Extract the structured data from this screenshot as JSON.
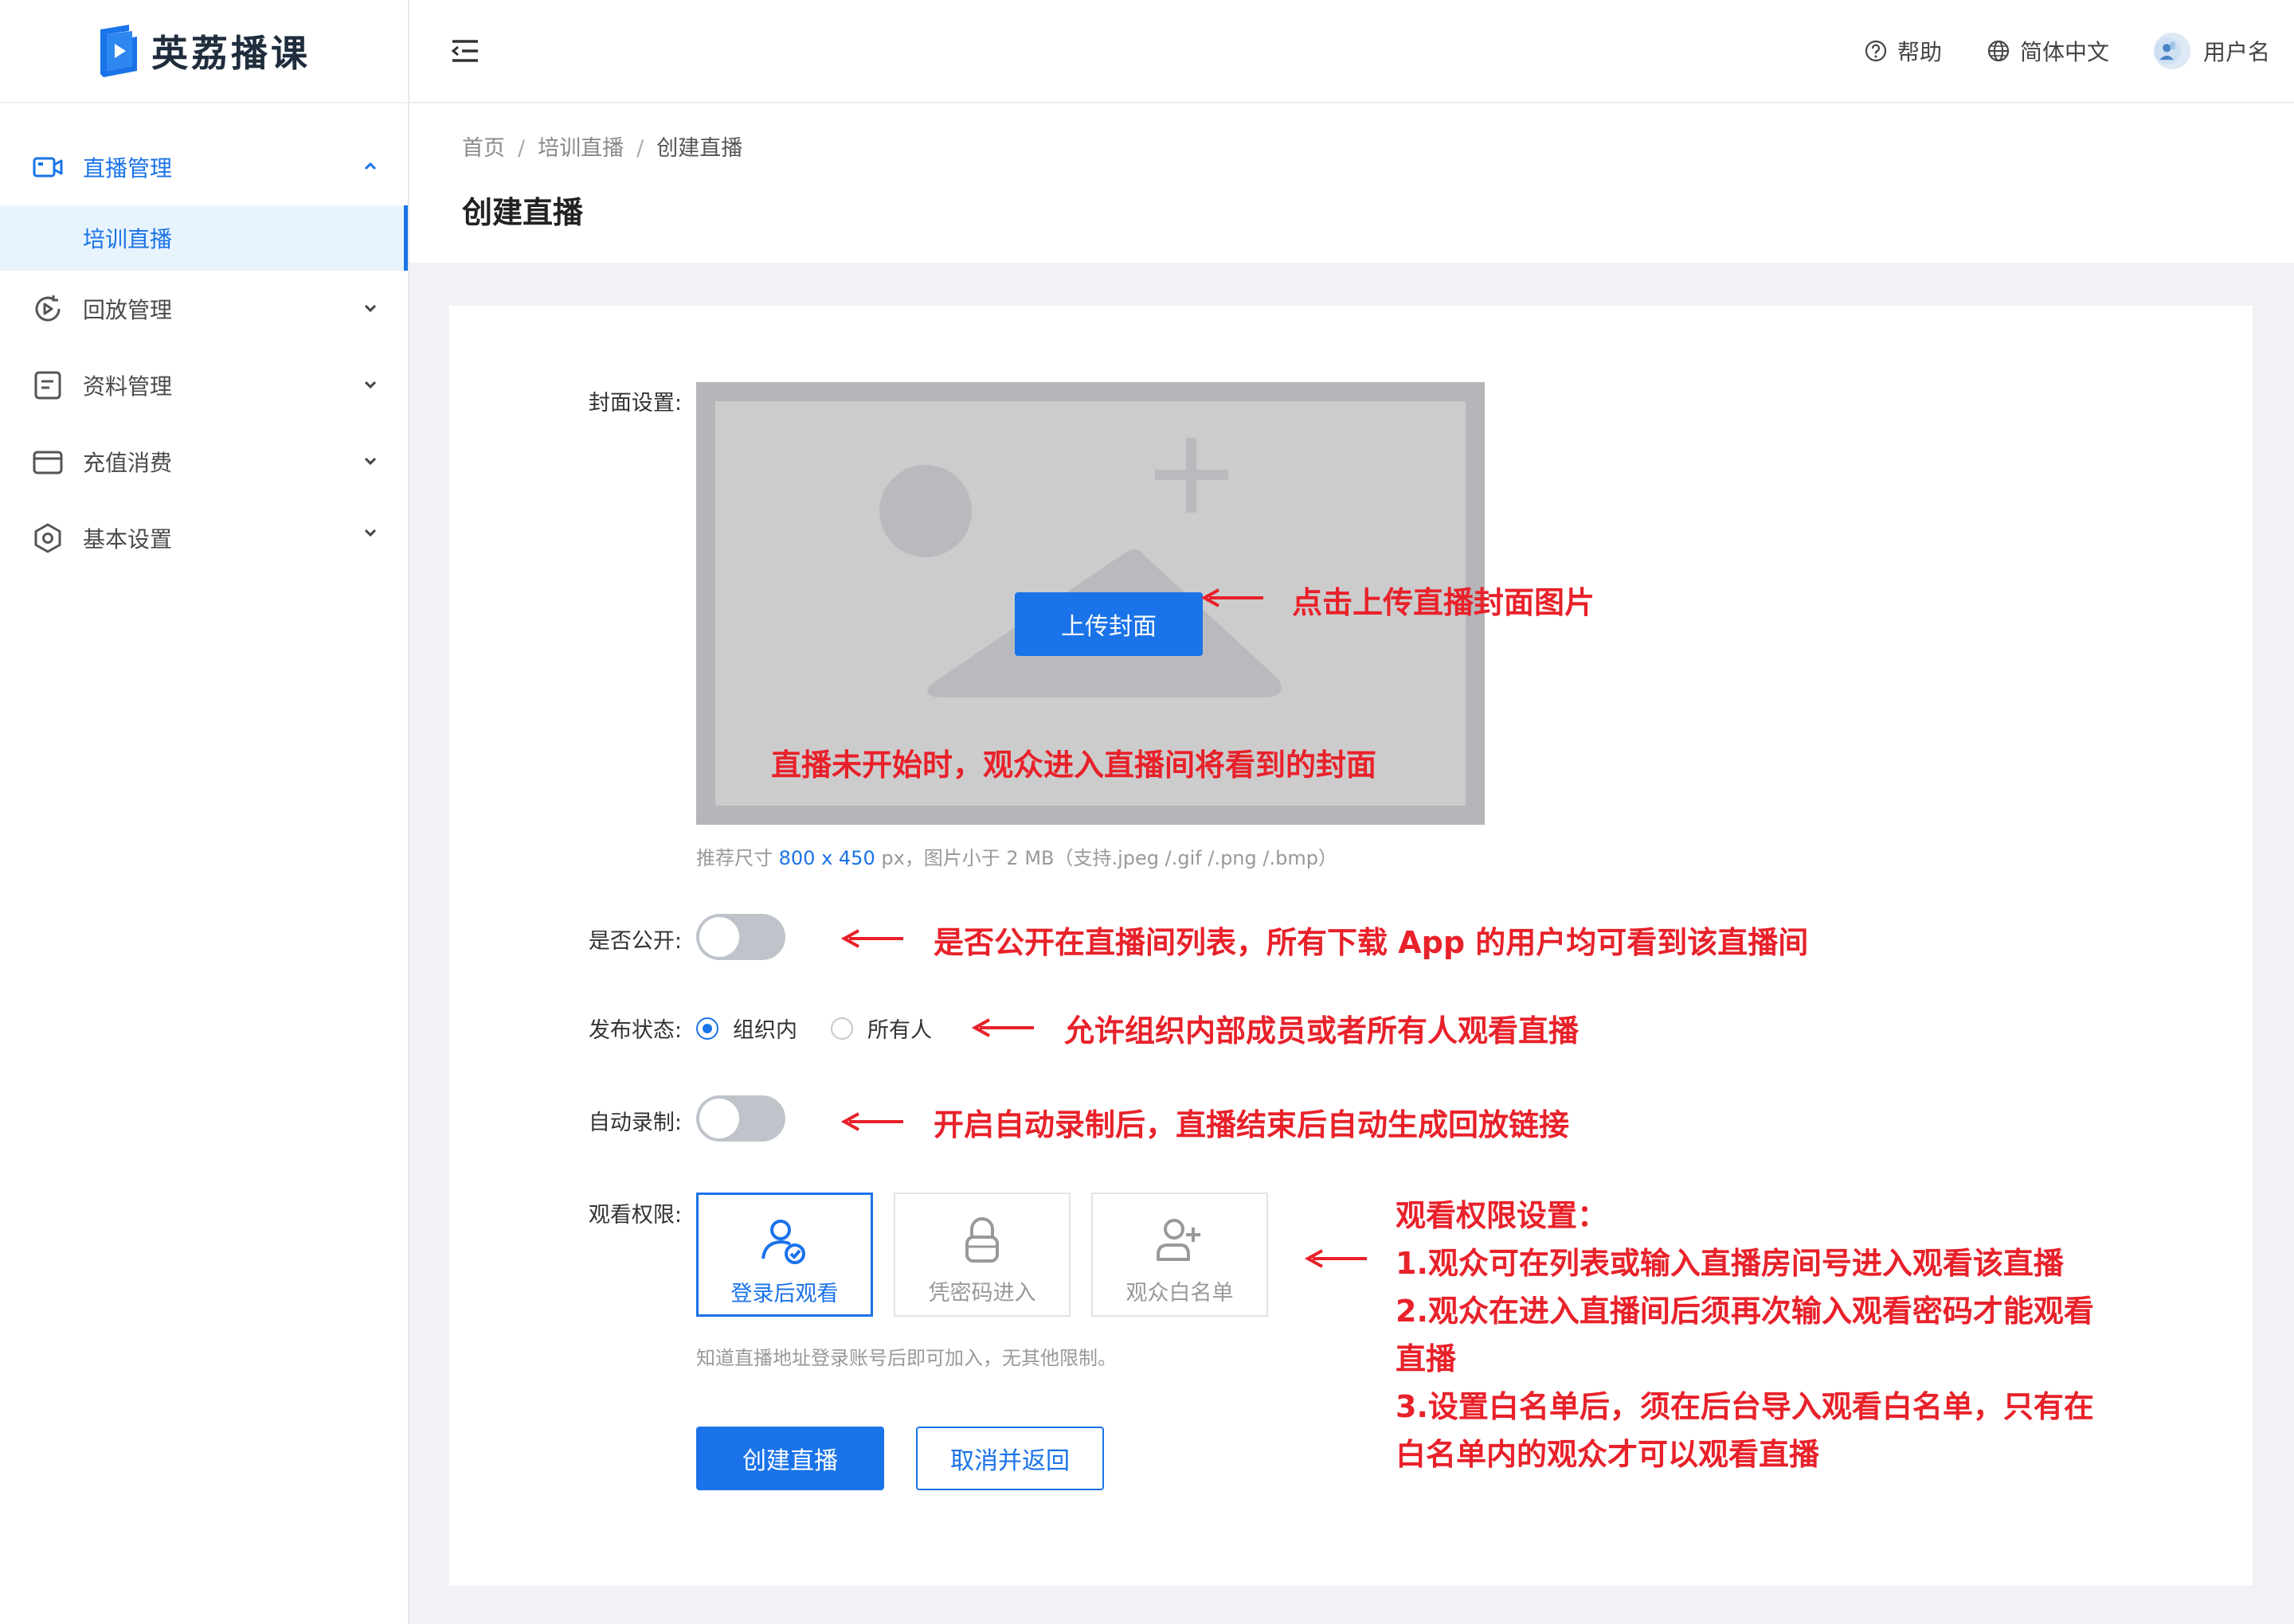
{
  "app": {
    "name": "英荔播课"
  },
  "sidebar": {
    "items": [
      {
        "label": "直播管理",
        "icon": "video-camera-icon",
        "expanded": true
      },
      {
        "label": "回放管理",
        "icon": "playback-icon"
      },
      {
        "label": "资料管理",
        "icon": "document-icon"
      },
      {
        "label": "充值消费",
        "icon": "wallet-icon"
      },
      {
        "label": "基本设置",
        "icon": "settings-icon"
      }
    ],
    "subitem": {
      "label": "培训直播"
    }
  },
  "header": {
    "help": "帮助",
    "language": "简体中文",
    "username": "用户名"
  },
  "breadcrumb": {
    "home": "首页",
    "section": "培训直播",
    "current": "创建直播",
    "separator": "/"
  },
  "page": {
    "title": "创建直播"
  },
  "form": {
    "cover_label": "封面设置:",
    "upload_button": "上传封面",
    "hint_prefix": "推荐尺寸",
    "hint_size": "800 x 450",
    "hint_suffix": "px，图片小于 2 MB（支持.jpeg /.gif /.png /.bmp）",
    "public_label": "是否公开:",
    "public_on": false,
    "status_label": "发布状态:",
    "status_options": [
      "组织内",
      "所有人"
    ],
    "status_selected": "组织内",
    "record_label": "自动录制:",
    "record_on": false,
    "permission_label": "观看权限:",
    "permissions": [
      "登录后观看",
      "凭密码进入",
      "观众白名单"
    ],
    "permission_selected": "登录后观看",
    "permission_hint": "知道直播地址登录账号后即可加入，无其他限制。",
    "submit": "创建直播",
    "cancel": "取消并返回"
  },
  "annotations": {
    "upload": "点击上传直播封面图片",
    "cover": "直播未开始时，观众进入直播间将看到的封面",
    "public": "是否公开在直播间列表，所有下载 App 的用户均可看到该直播间",
    "status": "允许组织内部成员或者所有人观看直播",
    "record": "开启自动录制后，直播结束后自动生成回放链接",
    "perm_title": "观看权限设置：",
    "perm_1": "1.观众可在列表或输入直播房间号进入观看该直播",
    "perm_2": "2.观众在进入直播间后须再次输入观看密码才能观看",
    "perm_2b": "直播",
    "perm_3": "3.设置白名单后，须在后台导入观看白名单，只有在",
    "perm_3b": "白名单内的观众才可以观看直播"
  },
  "colors": {
    "primary": "#1a73e8",
    "annotation": "#e8212a"
  }
}
